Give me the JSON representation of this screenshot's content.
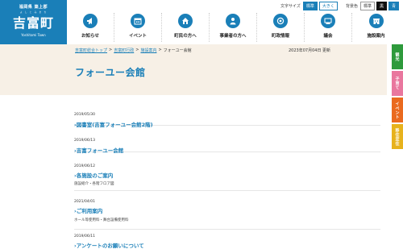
{
  "logo": {
    "prefecture": "福岡県 築上郡",
    "ruby": "よ し と み ま ち",
    "name": "吉富町",
    "sub": "Yoshitomi Town"
  },
  "utility": {
    "font_size_label": "文字サイズ",
    "font_standard": "標準",
    "font_large": "大きく",
    "color_label": "背景色",
    "color_standard": "標準",
    "color_black": "黒",
    "color_blue": "青"
  },
  "nav": [
    {
      "label": "お知らせ",
      "icon": "megaphone-icon"
    },
    {
      "label": "イベント",
      "icon": "calendar-icon"
    },
    {
      "label": "町民の方へ",
      "icon": "house-icon"
    },
    {
      "label": "事業者の方へ",
      "icon": "person-icon"
    },
    {
      "label": "町政情報",
      "icon": "town-emblem-icon"
    },
    {
      "label": "議会",
      "icon": "assembly-icon"
    },
    {
      "label": "施設案内",
      "icon": "building-icon"
    }
  ],
  "breadcrumb": {
    "items": [
      "吉富町総合トップ",
      "吉富町行政",
      "施設案内"
    ],
    "current": "フォーユー会館",
    "separator": ">"
  },
  "updated": "2023年07月04日 更新",
  "page_title": "フォーユー会館",
  "side_tabs": [
    {
      "label": "観光",
      "color": "#2e9a3c"
    },
    {
      "label": "子育て",
      "color": "#e9779e"
    },
    {
      "label": "イベント",
      "color": "#ea6a1f"
    },
    {
      "label": "移住定住",
      "color": "#e7b21c"
    }
  ],
  "entries": [
    {
      "date": "2019/05/30",
      "title": "図書室(吉富フォーユー会館2階)",
      "desc": ""
    },
    {
      "date": "2019/06/13",
      "title": "吉富フォーユー会館",
      "desc": ""
    },
    {
      "date": "2019/06/12",
      "title": "各施設のご案内",
      "desc": "施設紹介・各階フロア図"
    },
    {
      "date": "2021/04/01",
      "title": "ご利用案内",
      "desc": "ホール等使用料・舞台設備使用料"
    },
    {
      "date": "2019/06/11",
      "title": "アンケートのお願いについて",
      "desc": ""
    }
  ],
  "colors": {
    "brand": "#1a7fb8",
    "band": "#f7f0e6"
  }
}
